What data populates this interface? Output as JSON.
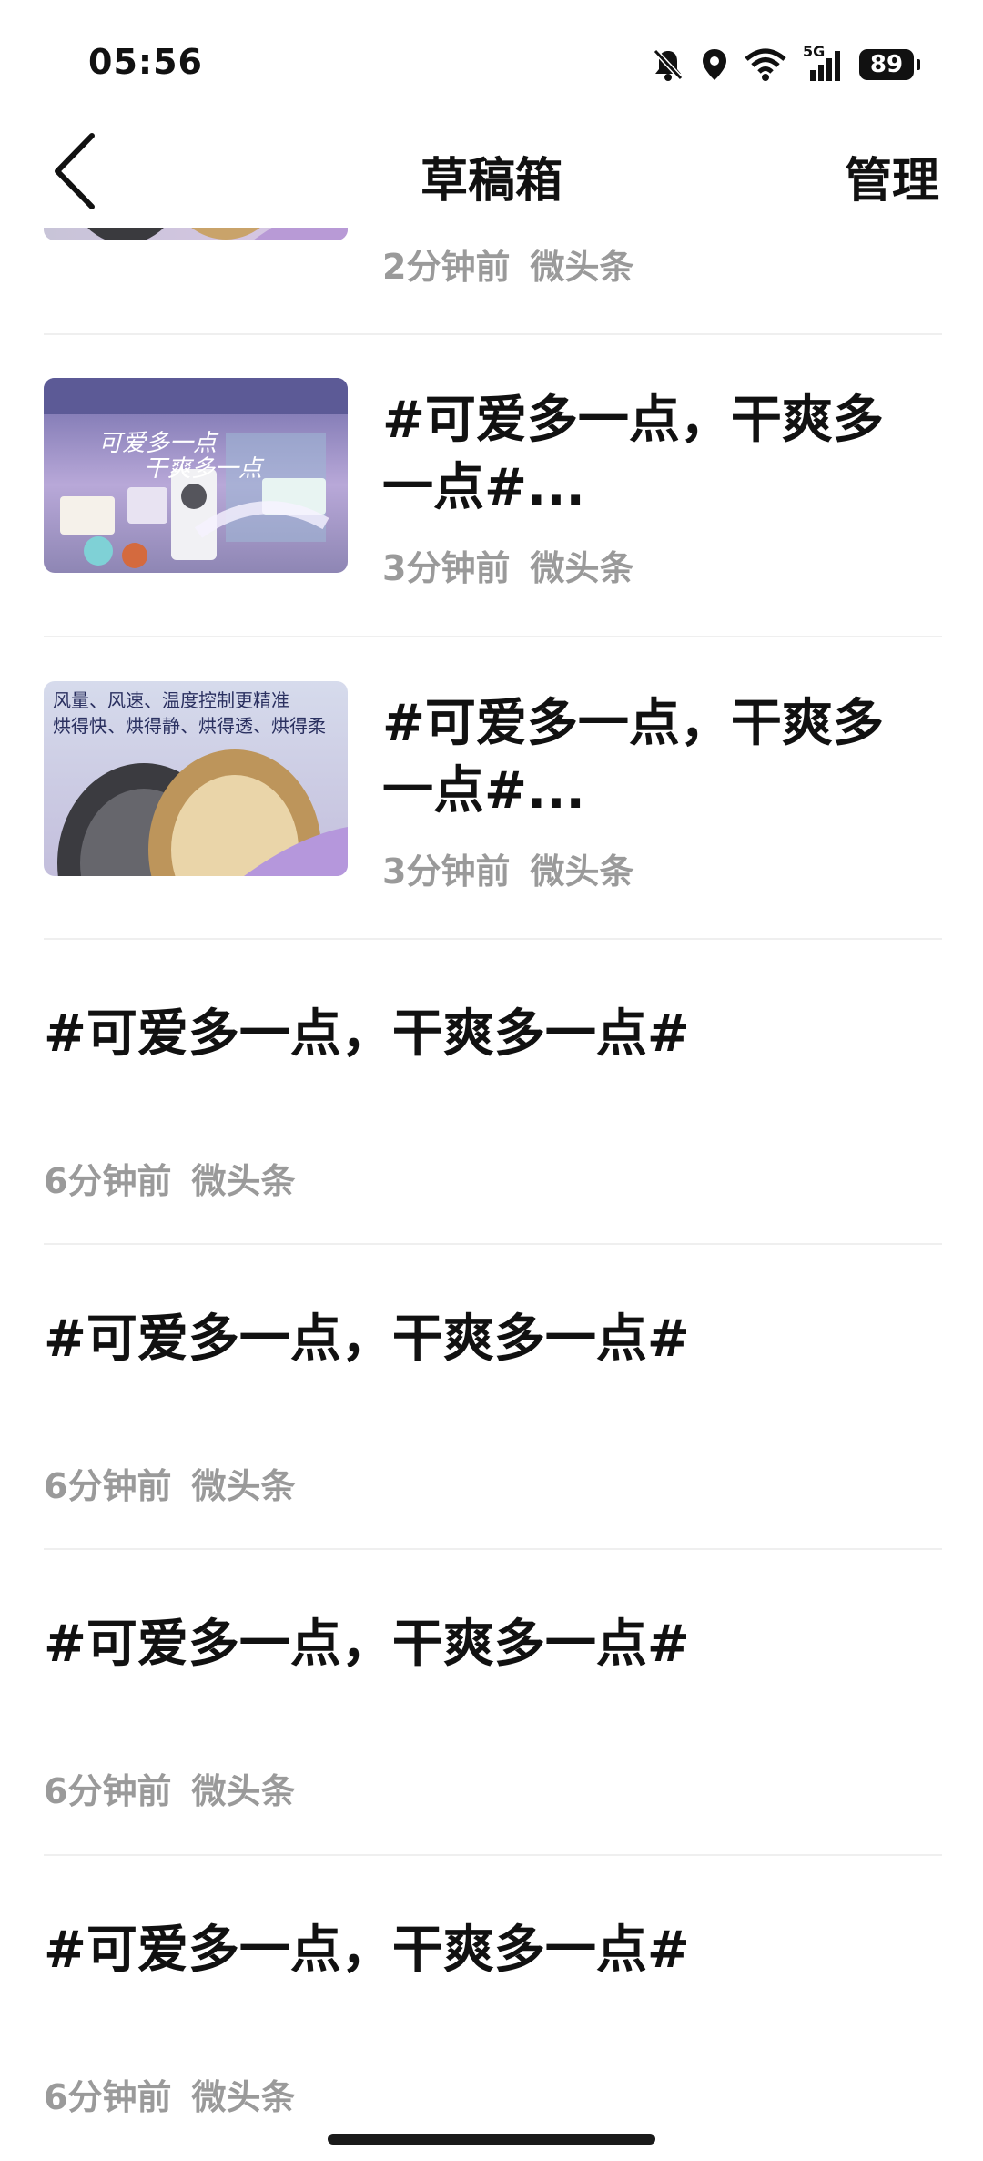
{
  "status_bar": {
    "time": "05:56",
    "battery": "89",
    "network": "5G",
    "icons": [
      "mute-bell-icon",
      "location-icon",
      "wifi-icon",
      "signal-icon",
      "battery-icon"
    ]
  },
  "nav": {
    "back_icon": "chevron-left-icon",
    "title": "草稿箱",
    "manage_label": "管理"
  },
  "drafts": [
    {
      "has_thumbnail": true,
      "thumb_style": "tire",
      "title": "",
      "time": "2分钟前",
      "source": "微头条"
    },
    {
      "has_thumbnail": true,
      "thumb_style": "room",
      "thumb_caption_1": "可爱多一点",
      "thumb_caption_2": "干爽多一点",
      "title": "#可爱多一点，干爽多一点#...",
      "time": "3分钟前",
      "source": "微头条"
    },
    {
      "has_thumbnail": true,
      "thumb_style": "tire-text",
      "thumb_line_1": "风量、风速、温度控制更精准",
      "thumb_line_2": "烘得快、烘得静、烘得透、烘得柔",
      "title": "#可爱多一点，干爽多一点#...",
      "time": "3分钟前",
      "source": "微头条"
    },
    {
      "has_thumbnail": false,
      "title": "#可爱多一点，干爽多一点#",
      "time": "6分钟前",
      "source": "微头条"
    },
    {
      "has_thumbnail": false,
      "title": "#可爱多一点，干爽多一点#",
      "time": "6分钟前",
      "source": "微头条"
    },
    {
      "has_thumbnail": false,
      "title": "#可爱多一点，干爽多一点#",
      "time": "6分钟前",
      "source": "微头条"
    },
    {
      "has_thumbnail": false,
      "title": "#可爱多一点，干爽多一点#",
      "time": "6分钟前",
      "source": "微头条"
    }
  ],
  "colors": {
    "title_text": "#111111",
    "meta_text": "#9a9a9a",
    "divider": "#efefef"
  }
}
